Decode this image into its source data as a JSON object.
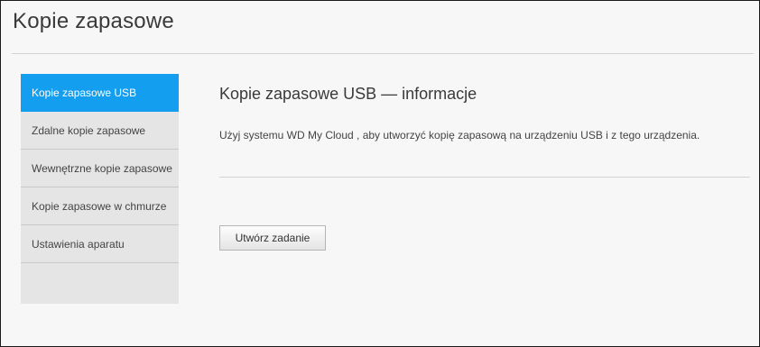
{
  "header": {
    "title": "Kopie zapasowe"
  },
  "sidebar": {
    "items": [
      {
        "label": "Kopie zapasowe USB",
        "active": true
      },
      {
        "label": "Zdalne kopie zapasowe",
        "active": false
      },
      {
        "label": "Wewnętrzne kopie zapasowe",
        "active": false
      },
      {
        "label": "Kopie zapasowe w chmurze",
        "active": false
      },
      {
        "label": "Ustawienia aparatu",
        "active": false
      }
    ]
  },
  "main": {
    "title": "Kopie zapasowe USB — informacje",
    "description": "Użyj systemu WD My Cloud , aby utworzyć kopię zapasową na urządzeniu USB i z tego urządzenia.",
    "create_button_label": "Utwórz zadanie"
  },
  "colors": {
    "accent": "#149ef0",
    "background": "#f7f7f7",
    "sidebar_background": "#e5e5e5"
  }
}
